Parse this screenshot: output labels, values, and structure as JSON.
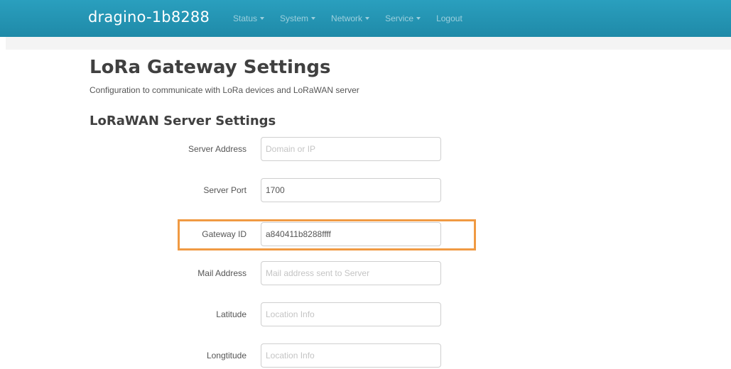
{
  "navbar": {
    "brand": "dragino-1b8288",
    "menu": [
      {
        "label": "Status"
      },
      {
        "label": "System"
      },
      {
        "label": "Network"
      },
      {
        "label": "Service"
      },
      {
        "label": "Logout"
      }
    ]
  },
  "page": {
    "title": "LoRa Gateway Settings",
    "description": "Configuration to communicate with LoRa devices and LoRaWAN server"
  },
  "section": {
    "title": "LoRaWAN Server Settings",
    "fields": [
      {
        "label": "Server Address",
        "value": "",
        "placeholder": "Domain or IP"
      },
      {
        "label": "Server Port",
        "value": "1700",
        "placeholder": ""
      },
      {
        "label": "Gateway ID",
        "value": "a840411b8288ffff",
        "placeholder": ""
      },
      {
        "label": "Mail Address",
        "value": "",
        "placeholder": "Mail address sent to Server"
      },
      {
        "label": "Latitude",
        "value": "",
        "placeholder": "Location Info"
      },
      {
        "label": "Longtitude",
        "value": "",
        "placeholder": "Location Info"
      }
    ]
  },
  "colors": {
    "navbar": "#2196b5",
    "highlight": "#f09a43"
  }
}
